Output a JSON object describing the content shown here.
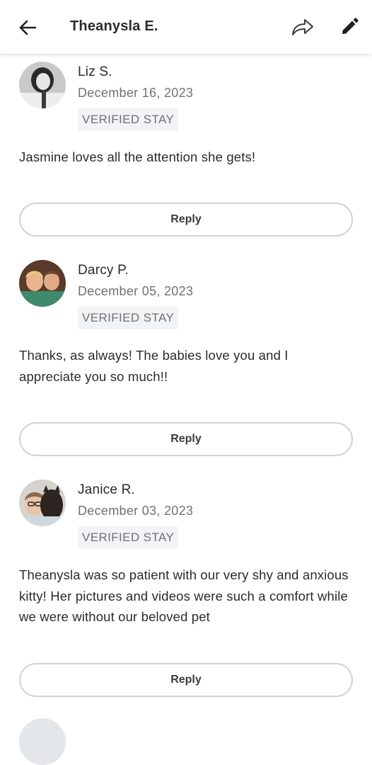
{
  "header": {
    "title": "Theanysla E.",
    "icons": {
      "back": "arrow-left-icon",
      "share": "share-arrow-icon",
      "edit": "pencil-icon"
    }
  },
  "reviews": [
    {
      "name": "Liz S.",
      "date": "December 16, 2023",
      "badge": "VERIFIED STAY",
      "text": "Jasmine loves all the attention she gets!",
      "reply_label": "Reply"
    },
    {
      "name": "Darcy P.",
      "date": "December 05, 2023",
      "badge": "VERIFIED STAY",
      "text": "Thanks, as always! The babies love you and I appreciate you so much!!",
      "reply_label": "Reply"
    },
    {
      "name": "Janice R.",
      "date": "December 03, 2023",
      "badge": "VERIFIED STAY",
      "text": "Theanysla was so patient with our very shy and anxious kitty! Her pictures and videos were such a comfort while we were without our beloved pet",
      "reply_label": "Reply"
    }
  ],
  "colors": {
    "text": "#2b2b2b",
    "muted": "#6f7275",
    "badge_bg": "#f1f3f5",
    "button_border": "#cfd4d8"
  }
}
